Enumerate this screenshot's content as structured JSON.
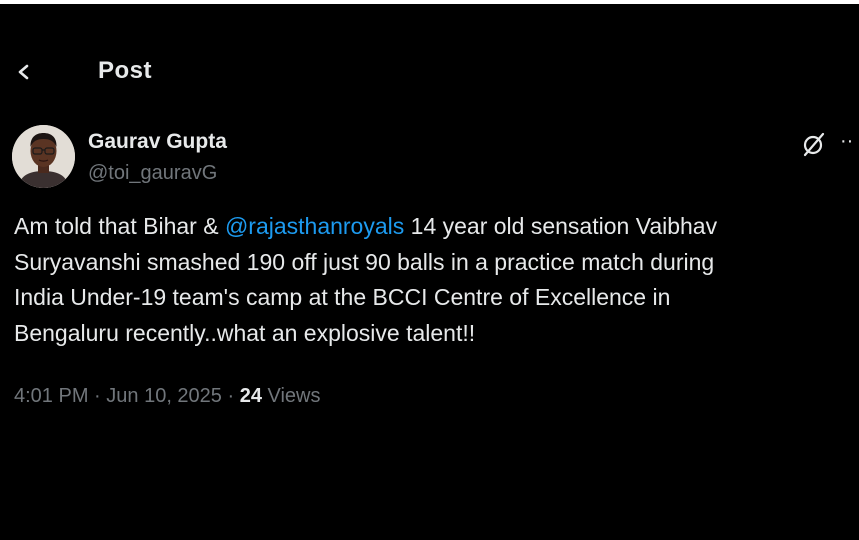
{
  "header": {
    "title": "Post",
    "back_icon": "arrow-left-icon"
  },
  "tweet": {
    "author": {
      "name": "Gaurav Gupta",
      "handle": "@toi_gauravG",
      "avatar_icon": "avatar-photo"
    },
    "actions": {
      "grok_icon": "grok-slash-icon",
      "more_label": "··"
    },
    "text": {
      "part1": "Am told that Bihar & ",
      "mention": "@rajasthanroyals",
      "part2": " 14 year old sensation Vaibhav\nSuryavanshi smashed 190 off just 90 balls in a practice match during\nIndia Under-19 team's camp at the BCCI Centre of Excellence in\nBengaluru recently..what an explosive talent!!"
    },
    "meta": {
      "time": "4:01 PM",
      "sep1": " · ",
      "date": "Jun 10, 2025",
      "sep2": " · ",
      "views_count": "24",
      "views_label": " Views"
    }
  },
  "colors": {
    "background": "#000000",
    "text_primary": "#e7e9ea",
    "text_secondary": "#71767b",
    "link": "#1d9bf0"
  }
}
